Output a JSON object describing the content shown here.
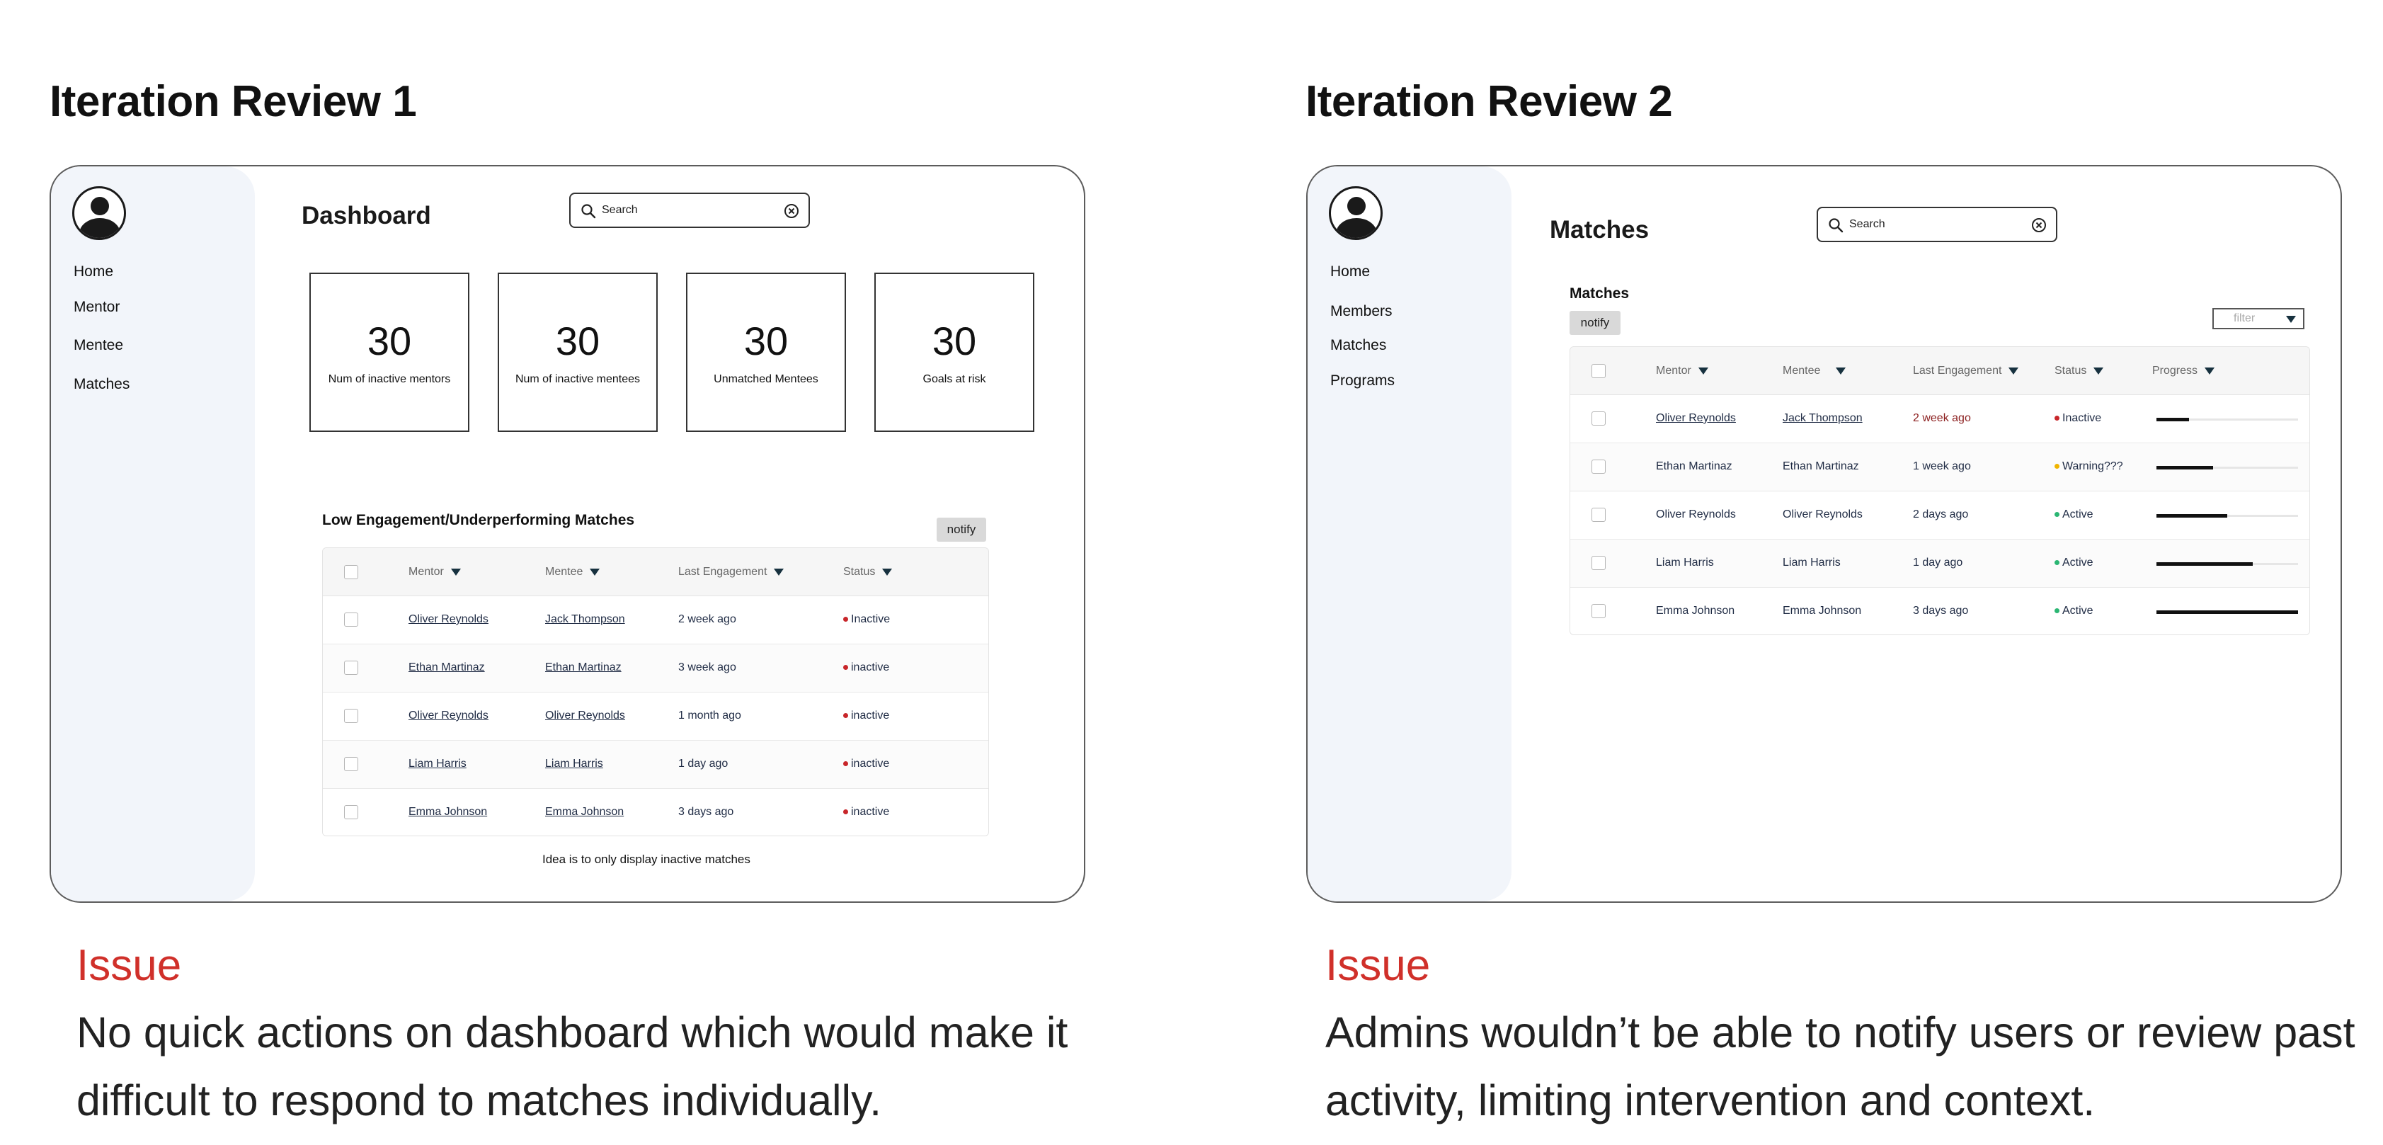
{
  "left": {
    "heading": "Iteration Review 1",
    "nav": [
      "Home",
      "Mentor",
      "Mentee",
      "Matches"
    ],
    "page_title": "Dashboard",
    "search_placeholder": "Search",
    "stats": [
      {
        "value": "30",
        "label": "Num of inactive mentors"
      },
      {
        "value": "30",
        "label": "Num of inactive mentees"
      },
      {
        "value": "30",
        "label": "Unmatched Mentees"
      },
      {
        "value": "30",
        "label": "Goals at risk"
      }
    ],
    "section_title": "Low Engagement/Underperforming Matches",
    "notify_label": "notify",
    "columns": [
      "Mentor",
      "Mentee",
      "Last Engagement",
      "Status"
    ],
    "rows": [
      {
        "mentor": "Oliver Reynolds",
        "mentee": "Jack Thompson",
        "last": "2 week ago",
        "status": "Inactive"
      },
      {
        "mentor": "Ethan Martinaz",
        "mentee": "Ethan Martinaz",
        "last": "3 week ago",
        "status": "inactive"
      },
      {
        "mentor": "Oliver Reynolds",
        "mentee": "Oliver Reynolds",
        "last": "1 month ago",
        "status": "inactive"
      },
      {
        "mentor": "Liam Harris",
        "mentee": "Liam Harris",
        "last": "1 day ago",
        "status": "inactive"
      },
      {
        "mentor": "Emma Johnson",
        "mentee": "Emma Johnson",
        "last": "3 days ago",
        "status": "inactive"
      }
    ],
    "note": "Idea is to only display inactive matches",
    "issue_heading": "Issue",
    "issue_text": "No quick actions on dashboard which would make it difficult to respond to matches individually."
  },
  "right": {
    "heading": "Iteration Review 2",
    "nav": [
      "Home",
      "Members",
      "Matches",
      "Programs"
    ],
    "page_title": "Matches",
    "search_placeholder": "Search",
    "section_title": "Matches",
    "notify_label": "notify",
    "filter_label": "filter",
    "columns": [
      "Mentor",
      "Mentee",
      "Last Engagement",
      "Status",
      "Progress"
    ],
    "rows": [
      {
        "mentor": "Oliver Reynolds",
        "mentee": "Jack Thompson",
        "last": "2 week ago",
        "status": "Inactive",
        "progress": 0.23
      },
      {
        "mentor": "Ethan Martinaz",
        "mentee": "Ethan Martinaz",
        "last": "1 week ago",
        "status": "Warning???",
        "progress": 0.4
      },
      {
        "mentor": "Oliver Reynolds",
        "mentee": "Oliver Reynolds",
        "last": "2 days ago",
        "status": "Active",
        "progress": 0.5
      },
      {
        "mentor": "Liam Harris",
        "mentee": "Liam Harris",
        "last": "1 day ago",
        "status": "Active",
        "progress": 0.68
      },
      {
        "mentor": "Emma Johnson",
        "mentee": "Emma Johnson",
        "last": "3 days ago",
        "status": "Active",
        "progress": 1.0
      }
    ],
    "issue_heading": "Issue",
    "issue_text": "Admins wouldn’t be able to notify users or review past activity, limiting intervention and context."
  },
  "colors": {
    "issue": "#d0302a",
    "inactive": "#c8262a",
    "warning": "#f0b400",
    "active": "#2bb673",
    "sidebar": "#f2f5fa",
    "sort_arrow": "#17313f"
  },
  "icons": [
    "user-avatar-icon",
    "search-icon",
    "clear-icon",
    "sort-arrow-icon",
    "status-dot-icon"
  ]
}
